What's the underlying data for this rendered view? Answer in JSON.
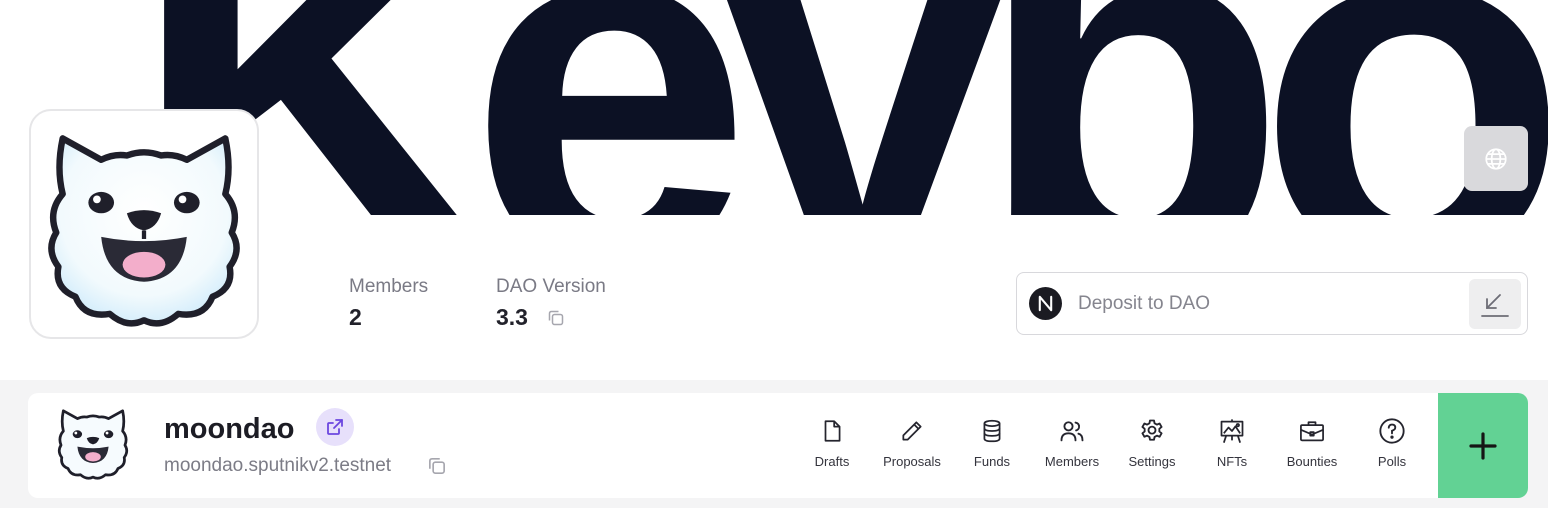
{
  "banner": {
    "text": "Kevbo"
  },
  "stats": {
    "members_label": "Members",
    "members_value": "2",
    "version_label": "DAO Version",
    "version_value": "3.3"
  },
  "deposit": {
    "label": "Deposit to DAO"
  },
  "dao": {
    "name": "moondao",
    "address": "moondao.sputnikv2.testnet"
  },
  "nav": {
    "items": [
      {
        "label": "Drafts",
        "icon": "file-icon"
      },
      {
        "label": "Proposals",
        "icon": "pencil-icon"
      },
      {
        "label": "Funds",
        "icon": "coins-icon"
      },
      {
        "label": "Members",
        "icon": "users-icon"
      },
      {
        "label": "Settings",
        "icon": "gear-icon"
      },
      {
        "label": "NFTs",
        "icon": "easel-icon"
      },
      {
        "label": "Bounties",
        "icon": "briefcase-icon"
      },
      {
        "label": "Polls",
        "icon": "question-icon"
      }
    ]
  },
  "colors": {
    "banner_text": "#0c1124",
    "add_button": "#62d294",
    "ext_link_bg": "#e7e0fb",
    "ext_link_icon": "#6b46e0"
  }
}
